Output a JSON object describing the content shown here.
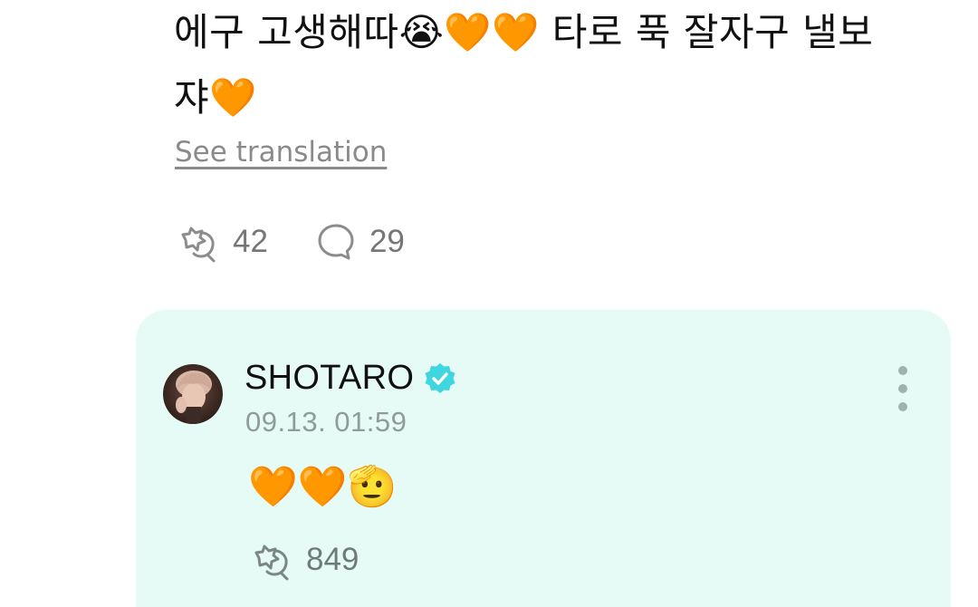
{
  "post": {
    "line1": "에구 고생해따😭🧡🧡 타로 푹 잘자구 낼보",
    "line2": "쟈🧡",
    "see_translation": "See translation",
    "reaction_count": "42",
    "comment_count": "29"
  },
  "reply": {
    "author": "SHOTARO",
    "timestamp": "09.13. 01:59",
    "text": "🧡🧡🫡",
    "reaction_count": "849"
  },
  "icons": {
    "reaction": "sparkle-pop-icon",
    "comment": "speech-bubble-icon",
    "verified": "verified-badge-icon",
    "more": "more-vertical-icon"
  },
  "colors": {
    "card_background": "#e6fbf6",
    "verified_badge": "#3fd6e0",
    "muted_text": "#8a8a8a"
  }
}
